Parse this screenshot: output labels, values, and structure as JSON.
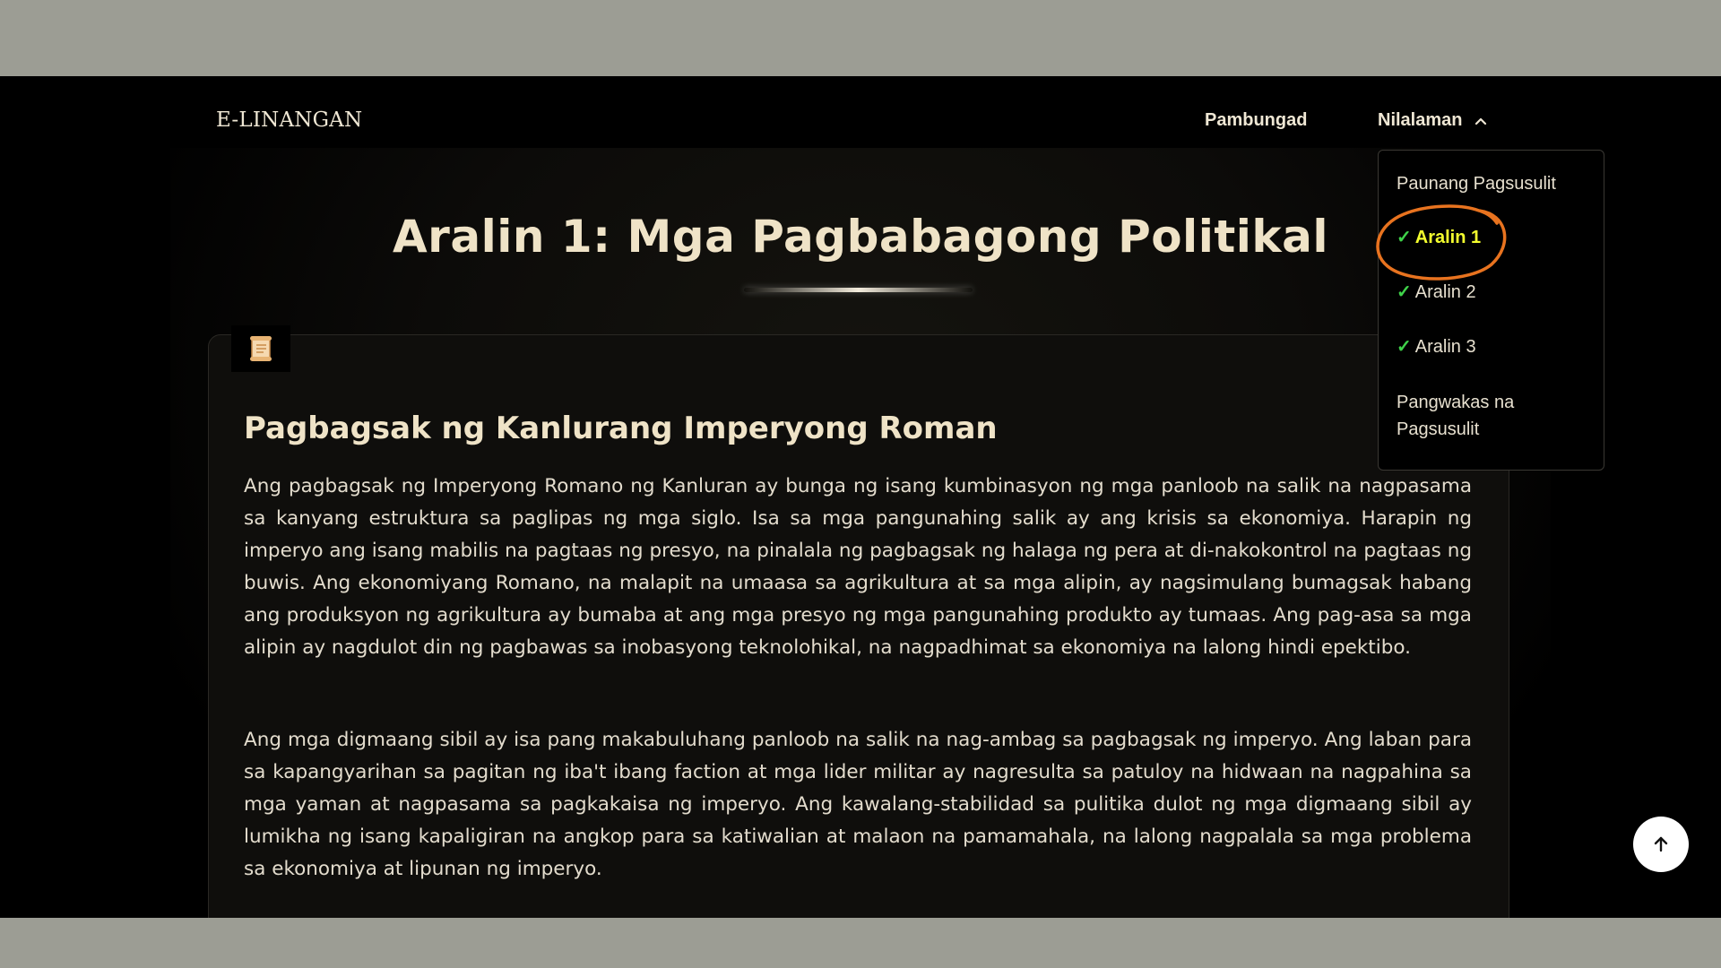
{
  "header": {
    "logo": "E-LINANGAN",
    "nav": {
      "pambungad": "Pambungad",
      "nilalaman": "Nilalaman"
    }
  },
  "dropdown": {
    "items": [
      {
        "label": "Paunang Pagsusulit",
        "checked": false
      },
      {
        "label": "Aralin 1",
        "checked": true,
        "active": true
      },
      {
        "label": "Aralin 2",
        "checked": true
      },
      {
        "label": "Aralin 3",
        "checked": true
      },
      {
        "label": "Pangwakas na Pagsusulit",
        "checked": false
      }
    ],
    "check_mark": "✓"
  },
  "main": {
    "page_title": "Aralin 1: Mga Pagbabagong Politikal",
    "section_title": "Pagbagsak ng Kanlurang Imperyong Roman",
    "paragraphs": [
      "Ang pagbagsak ng Imperyong Romano ng Kanluran ay bunga ng isang kumbinasyon ng mga panloob na salik na nagpasama sa kanyang estruktura sa paglipas ng mga siglo. Isa sa mga pangunahing salik ay ang krisis sa ekonomiya. Harapin ng imperyo ang isang mabilis na pagtaas ng presyo, na pinalala ng pagbagsak ng halaga ng pera at di-nakokontrol na pagtaas ng buwis. Ang ekonomiyang Romano, na malapit na umaasa sa agrikultura at sa mga alipin, ay nagsimulang bumagsak habang ang produksyon ng agrikultura ay bumaba at ang mga presyo ng mga pangunahing produkto ay tumaas. Ang pag-asa sa mga alipin ay nagdulot din ng pagbawas sa inobasyong teknolohikal, na nagpadhimat sa ekonomiya na lalong hindi epektibo.",
      "Ang mga digmaang sibil ay isa pang makabuluhang panloob na salik na nag-ambag sa pagbagsak ng imperyo. Ang laban para sa kapangyarihan sa pagitan ng iba't ibang faction at mga lider militar ay nagresulta sa patuloy na hidwaan na nagpahina sa mga yaman at nagpasama sa pagkakaisa ng imperyo. Ang kawalang-stabilidad sa pulitika dulot ng mga digmaang sibil ay lumikha ng isang kapaligiran na angkop para sa katiwalian at malaon na pamamahala, na lalong nagpalala sa mga problema sa ekonomiya at lipunan ng imperyo."
    ],
    "icon": "scroll-icon"
  },
  "scroll_top": {
    "icon": "arrow-up-icon"
  },
  "colors": {
    "background": "#000000",
    "card": "#0f0e0c",
    "title": "#efe3c7",
    "active_item": "#f4ff2e",
    "check": "#3fd34a",
    "highlight_ring": "#e8731f"
  }
}
